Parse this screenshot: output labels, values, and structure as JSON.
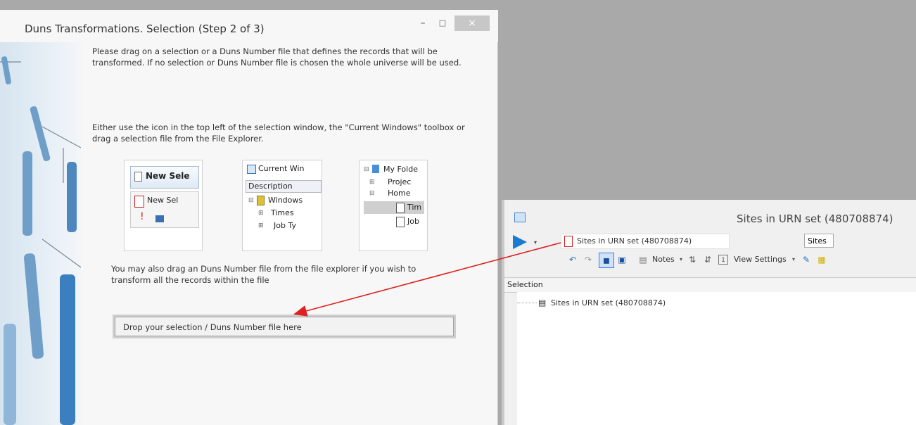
{
  "wizard": {
    "title": "Duns Transformations. Selection (Step 2 of 3)",
    "controls": {
      "minimize": "–",
      "maximize": "□",
      "close": "×"
    },
    "paragraph1": "Please drag on a selection or a Duns Number file that defines the records that will be transformed. If no selection or Duns Number file is chosen the whole universe will be used.",
    "paragraph2": "Either use the icon in the top left of the selection window, the \"Current Windows\" toolbox or drag a selection file from the File Explorer.",
    "paragraph3": "You may also drag an Duns Number file from the file explorer if you wish to transform all the records within the file",
    "drop_zone": "Drop your selection / Duns Number file here",
    "thumbnails": {
      "new_selection": {
        "title": "New Sele",
        "item": "New Sel"
      },
      "current_windows": {
        "title": "Current Win",
        "column": "Description",
        "items": [
          "Windows",
          "Times",
          "Job Ty"
        ]
      },
      "file_explorer": {
        "items": [
          "My Folde",
          "Projec",
          "Home",
          "Tim",
          "Job"
        ]
      }
    }
  },
  "selection_window": {
    "title": "Sites in URN set (480708874)",
    "name_field": "Sites in URN set (480708874)",
    "sites_field": "Sites",
    "toolbar": {
      "notes_label": "Notes",
      "view_settings_label": "View Settings"
    },
    "header": "Selection",
    "tree_item": "Sites in URN set (480708874)"
  },
  "colors": {
    "arrow": "#e02020",
    "accent_blue": "#1a7bd0"
  }
}
